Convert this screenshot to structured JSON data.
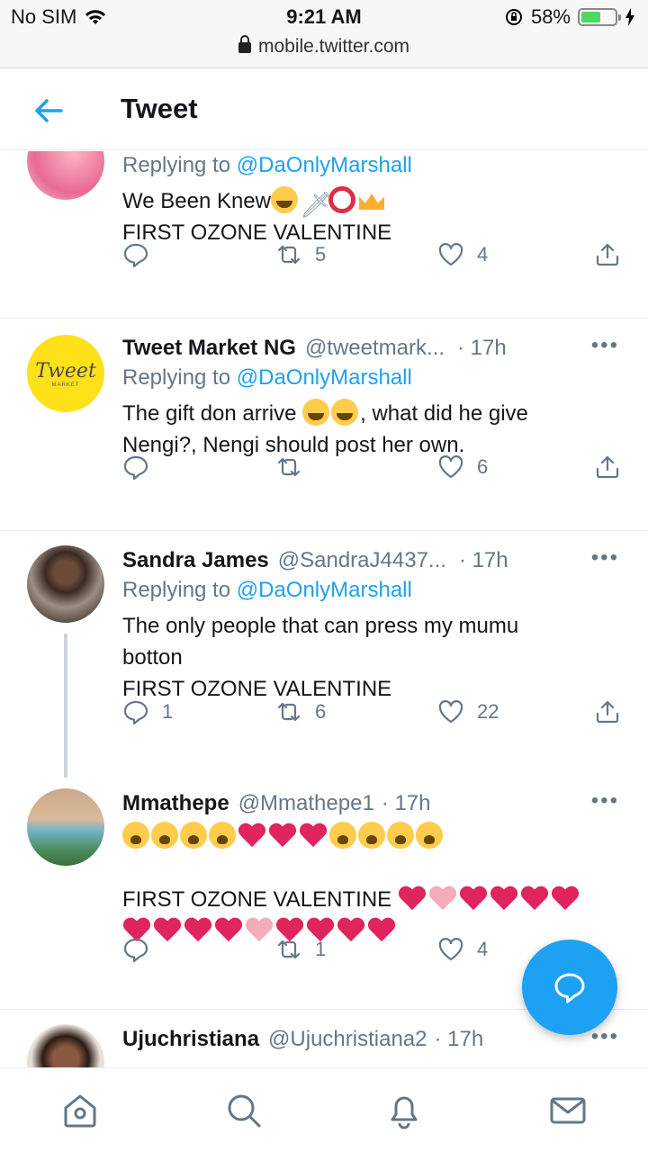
{
  "status": {
    "carrier": "No SIM",
    "time": "9:21 AM",
    "battery_pct": "58%",
    "battery_level": 0.58,
    "url": "mobile.twitter.com"
  },
  "header": {
    "title": "Tweet"
  },
  "tweets": [
    {
      "reply_prefix": "Replying to",
      "reply_to": "@DaOnlyMarshall",
      "lines": [
        "We Been Knew",
        "FIRST OZONE VALENTINE"
      ],
      "retweets": "5",
      "likes": "4",
      "replies": ""
    },
    {
      "name": "Tweet Market NG",
      "handle": "@tweetmark...",
      "time": "· 17h",
      "reply_prefix": "Replying to",
      "reply_to": "@DaOnlyMarshall",
      "lines": [
        "The gift don arrive",
        ", what did he give",
        "Nengi?, Nengi should post her own."
      ],
      "avatar_text": "Tweet",
      "avatar_subtext": "MARKET",
      "replies": "",
      "retweets": "",
      "likes": "6"
    },
    {
      "name": "Sandra James",
      "handle": "@SandraJ4437...",
      "time": "· 17h",
      "reply_prefix": "Replying to",
      "reply_to": "@DaOnlyMarshall",
      "lines": [
        "The only people that can press my mumu",
        "botton",
        "FIRST OZONE VALENTINE"
      ],
      "replies": "1",
      "retweets": "6",
      "likes": "22"
    },
    {
      "name": "Mmathepe",
      "handle": "@Mmathepe1",
      "time": "· 17h",
      "lines": [
        "FIRST OZONE VALENTINE"
      ],
      "replies": "",
      "retweets": "1",
      "likes": "4"
    },
    {
      "name": "Ujuchristiana",
      "handle": "@Ujuchristiana2",
      "time": "· 17h"
    }
  ],
  "icons": {
    "back": "arrow-left-icon",
    "reply": "reply-icon",
    "retweet": "retweet-icon",
    "like": "heart-icon",
    "share": "share-icon",
    "compose": "compose-reply-icon",
    "home": "home-icon",
    "search": "search-icon",
    "notifications": "bell-icon",
    "messages": "mail-icon"
  },
  "colors": {
    "accent": "#1da1f2",
    "muted": "#657786",
    "text": "#14171a",
    "divider": "#e6ecf0"
  }
}
